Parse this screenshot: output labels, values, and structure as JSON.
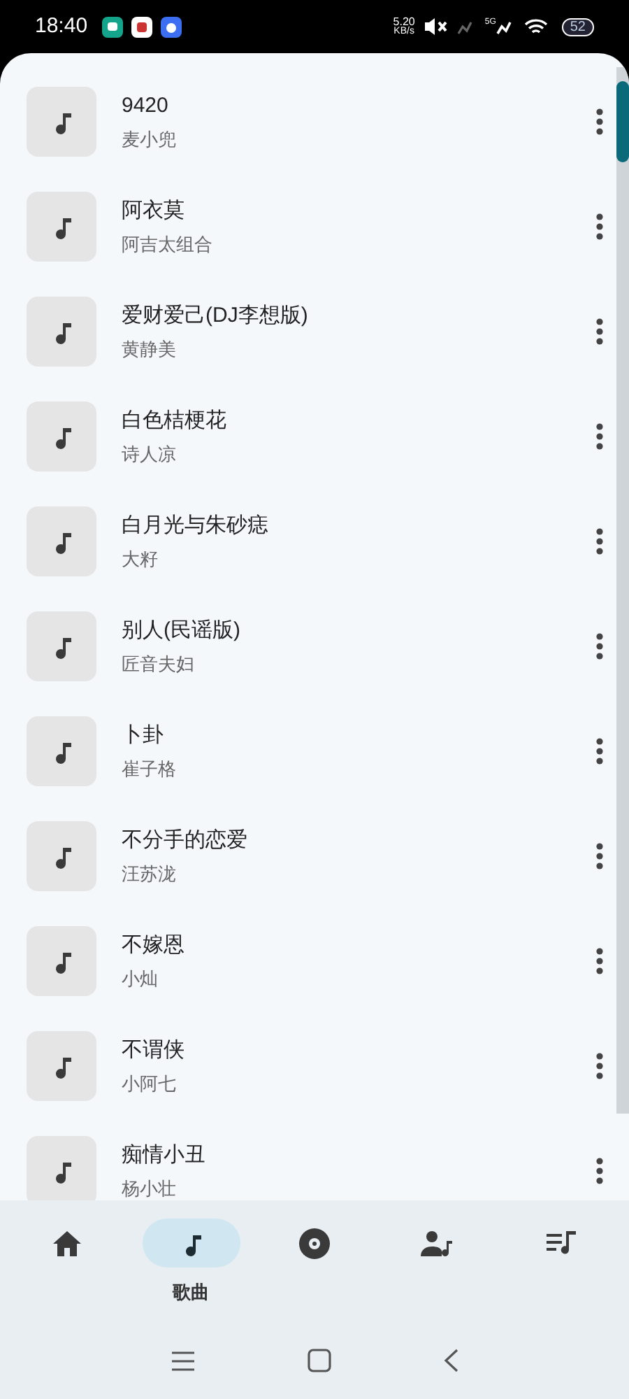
{
  "status_bar": {
    "time": "18:40",
    "speed_value": "5.20",
    "speed_unit": "KB/s",
    "network": "5G",
    "battery": "52"
  },
  "songs": [
    {
      "title": "9420",
      "artist": "麦小兜"
    },
    {
      "title": "阿衣莫",
      "artist": "阿吉太组合"
    },
    {
      "title": "爱财爱己(DJ李想版)",
      "artist": "黄静美"
    },
    {
      "title": "白色桔梗花",
      "artist": "诗人凉"
    },
    {
      "title": "白月光与朱砂痣",
      "artist": "大籽"
    },
    {
      "title": "别人(民谣版)",
      "artist": "匠音夫妇"
    },
    {
      "title": "卜卦",
      "artist": "崔子格"
    },
    {
      "title": "不分手的恋爱",
      "artist": "汪苏泷"
    },
    {
      "title": "不嫁恩",
      "artist": "小灿"
    },
    {
      "title": "不谓侠",
      "artist": "小阿七"
    },
    {
      "title": "痴情小丑",
      "artist": "杨小壮"
    }
  ],
  "bottom_nav": [
    {
      "kind": "home",
      "selected": false
    },
    {
      "kind": "songs",
      "selected": true,
      "label": "歌曲"
    },
    {
      "kind": "album",
      "selected": false
    },
    {
      "kind": "artist",
      "selected": false
    },
    {
      "kind": "playlist",
      "selected": false
    }
  ]
}
